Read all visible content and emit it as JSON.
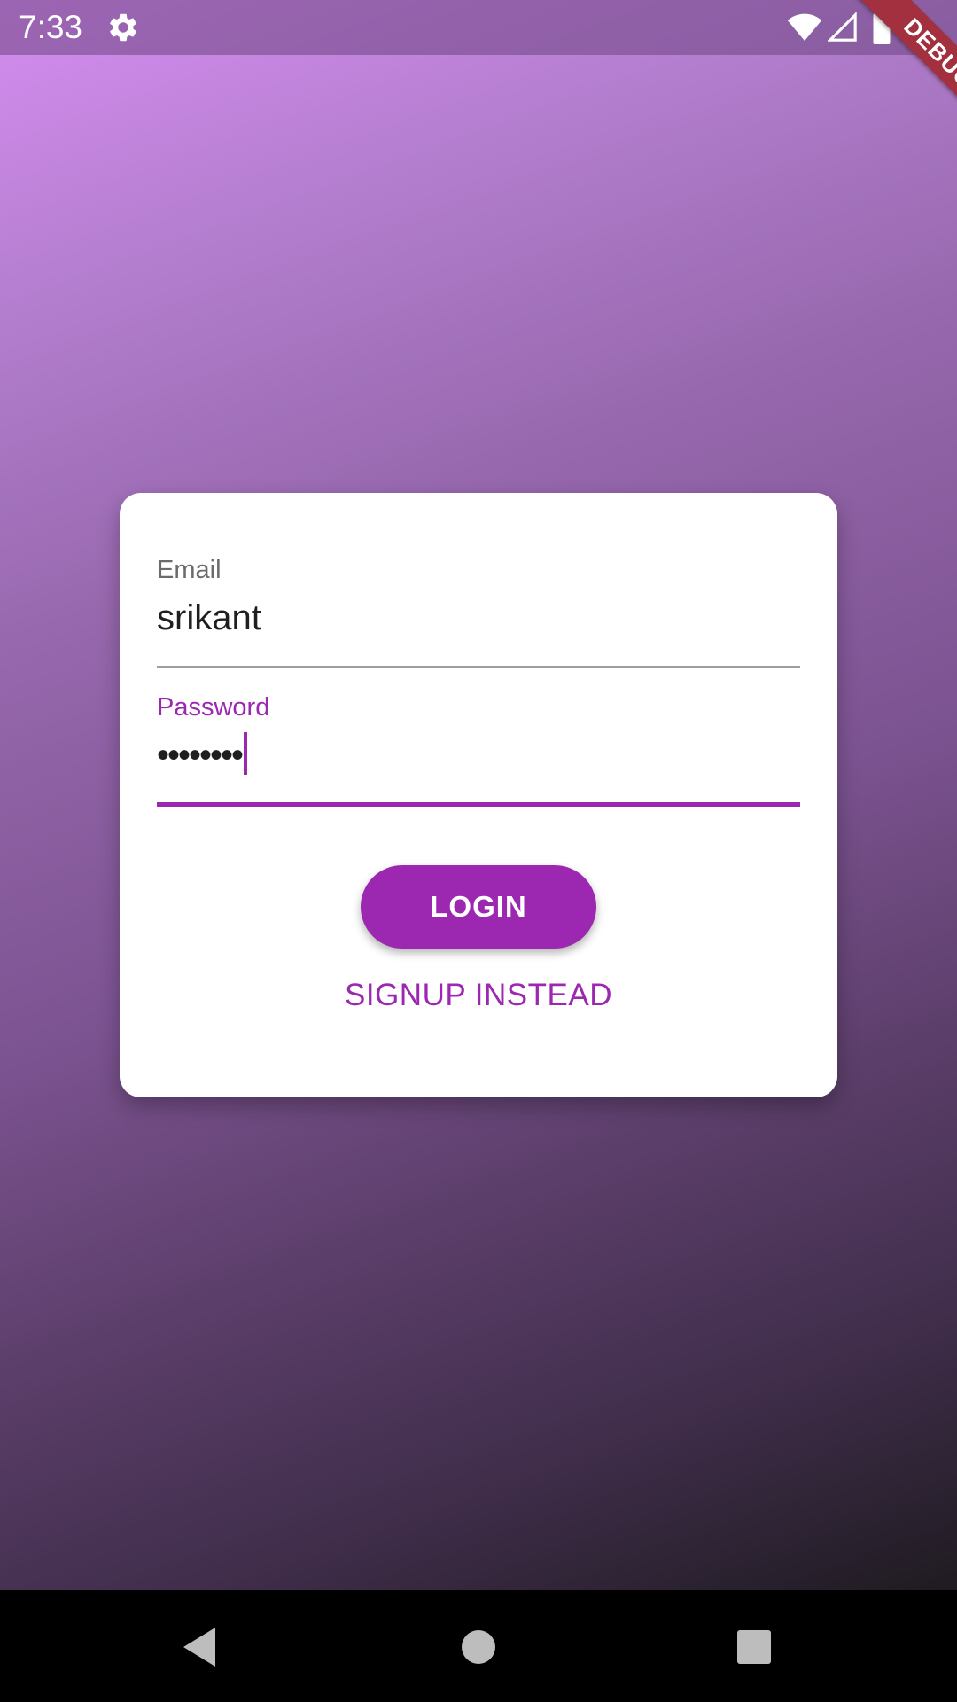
{
  "status_bar": {
    "time": "7:33",
    "icons": [
      "gear-icon",
      "wifi-icon",
      "signal-icon",
      "battery-icon"
    ]
  },
  "debug_banner": {
    "label": "DEBUG",
    "color": "#a3303f"
  },
  "login_form": {
    "email": {
      "label": "Email",
      "value": "srikant"
    },
    "password": {
      "label": "Password",
      "masked_value": "••••••••"
    },
    "login_label": "LOGIN",
    "signup_label": "SIGNUP INSTEAD"
  },
  "navigation_bar": {
    "icons": [
      "back-icon",
      "home-icon",
      "recents-icon"
    ]
  },
  "colors": {
    "accent": "#9c27b0",
    "card_background": "#ffffff",
    "gradient_top": "#d58df0",
    "gradient_bottom": "#1f1b21"
  }
}
